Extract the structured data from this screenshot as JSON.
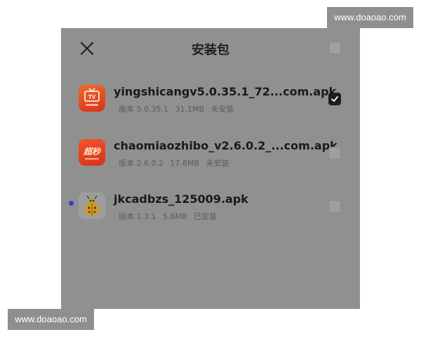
{
  "watermark": {
    "top": "www.doaoao.com",
    "bottom": "www.doaoao.com"
  },
  "dialog": {
    "title": "安装包",
    "select_all_checked": false
  },
  "packages": [
    {
      "name": "yingshicangv5.0.35.1_72...com.apk",
      "version": "版本 5.0.35.1",
      "size": "31.1MB",
      "status": "未安装",
      "checked": true,
      "icon": "tv-app-icon",
      "icon_text": "TV",
      "accent": "#e04a1a"
    },
    {
      "name": "chaomiaozhibo_v2.6.0.2_...com.apk",
      "version": "版本 2.6.0.2",
      "size": "17.8MB",
      "status": "未安装",
      "checked": false,
      "icon": "chaomiao-app-icon",
      "icon_text": "超秒",
      "accent": "#e2421f"
    },
    {
      "name": "jkcadbzs_125009.apk",
      "version": "版本 1.3.1",
      "size": "5.6MB",
      "status": "已安装",
      "checked": false,
      "icon": "ladybug-app-icon",
      "unread_dot": true,
      "accent": "#d9a020"
    }
  ]
}
